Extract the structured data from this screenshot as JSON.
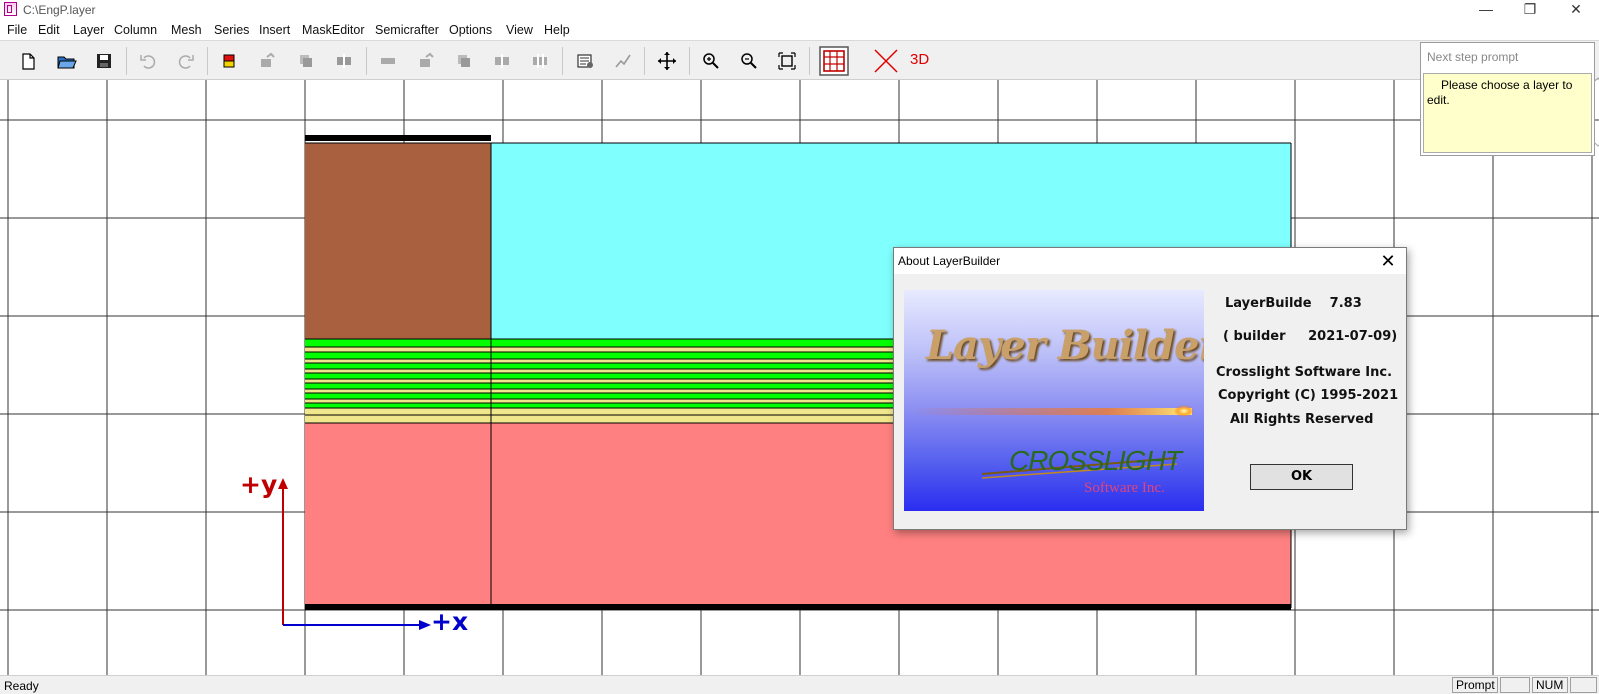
{
  "window": {
    "title": "C:\\EngP.layer",
    "minimize_icon": "minimize-icon",
    "restore_icon": "restore-icon",
    "close_icon": "close-icon"
  },
  "menu": [
    "File",
    "Edit",
    "Layer",
    "Column",
    "Mesh",
    "Series",
    "Insert",
    "MaskEditor",
    "Semicrafter",
    "Options",
    "View",
    "Help"
  ],
  "toolbar": {
    "buttons": [
      "new-file-icon",
      "open-folder-icon",
      "save-icon",
      "undo-icon",
      "redo-icon",
      "layer-color-icon",
      "layer-edit-icon",
      "layer-copy-icon",
      "layer-split-icon",
      "column-icon",
      "column-edit-icon",
      "column-copy-icon",
      "column-split-icon",
      "column-merge-icon",
      "properties-icon",
      "graph-icon",
      "move-icon",
      "zoom-in-icon",
      "zoom-out-icon",
      "fit-view-icon",
      "grid-icon",
      "clear-icon"
    ],
    "label_3d": "3D",
    "colors": {
      "3d": "#e00000",
      "grid_icon": "#c00000",
      "clear_icon": "#e00000"
    }
  },
  "canvas": {
    "axis_y_label": "+y",
    "axis_x_label": "+x",
    "colors": {
      "brown": "#a9603e",
      "cyan": "#80ffff",
      "green": "#00ff00",
      "yellow": "#f0e68c",
      "salmon": "#ff8080",
      "axis_y": "#c00000",
      "axis_x": "#0000cc"
    }
  },
  "prompt_panel": {
    "title": "Next step prompt",
    "text": "Please choose a layer to edit."
  },
  "about_dialog": {
    "title": "About LayerBuilder",
    "close_icon": "close-icon",
    "logo_title": "Layer Builder",
    "logo_brand": "CROSSLIGHT",
    "logo_sub": "Software Inc.",
    "product_line": "LayerBuilde    7.83",
    "build_line": "( builder     2021-07-09)",
    "company": "Crosslight Software Inc.",
    "copyright": "Copyright (C) 1995-2021",
    "rights": "All Rights Reserved",
    "ok_label": "OK"
  },
  "status": {
    "text": "Ready",
    "panes": [
      "Prompt",
      "",
      "NUM",
      ""
    ]
  }
}
